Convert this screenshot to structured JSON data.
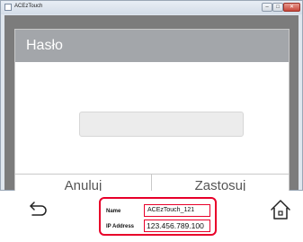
{
  "window": {
    "title": "ACEzTouch",
    "close_glyph": "✕"
  },
  "dialog": {
    "title": "Hasło",
    "password_value": "",
    "cancel_label": "Anuluj",
    "apply_label": "Zastosuj"
  },
  "bottombar": {
    "back_icon": "back-arrow-icon",
    "home_icon": "home-icon",
    "name_label": "Name",
    "name_value": "ACEzTouch_121",
    "ip_label": "IP Address",
    "ip_value": "123.456.789.100"
  },
  "colors": {
    "highlight": "#e8002a",
    "header": "#a3a6aa",
    "overlay": "#7c7c7c"
  }
}
